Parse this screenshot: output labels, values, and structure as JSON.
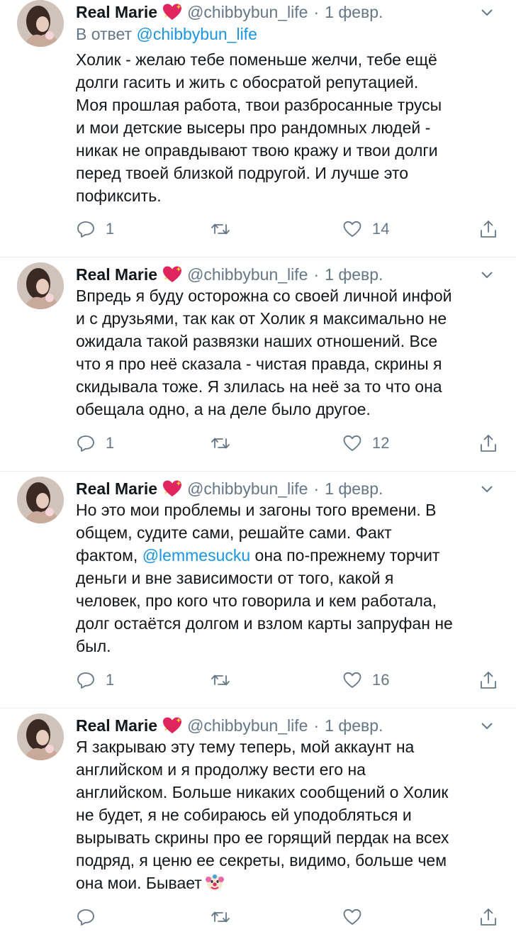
{
  "tweets": [
    {
      "author_name": "Real Marie",
      "handle": "@chibbybun_life",
      "separator": "·",
      "date": "1 февр.",
      "reply_prefix": "В ответ",
      "reply_to": "@chibbybun_life",
      "lines": [
        "Холик - желаю тебе поменьше желчи, тебе ещё",
        "долги гасить и жить с обосратой репутацией.",
        "Моя прошлая работа, твои разбросанные трусы",
        "и мои детские высеры про рандомных людей -",
        "никак не оправдывают твою кражу и твои долги",
        "перед твоей близкой подругой. И лучше это",
        "пофиксить."
      ],
      "reply_count": "1",
      "retweet_count": "",
      "like_count": "14"
    },
    {
      "author_name": "Real Marie",
      "handle": "@chibbybun_life",
      "separator": "·",
      "date": "1 февр.",
      "lines": [
        "Впредь я буду осторожна со своей личной инфой",
        "и с друзьями, так как от Холик я максимально не",
        "ожидала такой развязки наших отношений. Все",
        "что я про неё сказала - чистая правда, скрины я",
        "скидывала тоже. Я злилась на неё за то что она",
        "обещала одно, а на деле было другое."
      ],
      "reply_count": "1",
      "retweet_count": "",
      "like_count": "12"
    },
    {
      "author_name": "Real Marie",
      "handle": "@chibbybun_life",
      "separator": "·",
      "date": "1 февр.",
      "lines_before": [
        "Но это мои проблемы и загоны того времени. В",
        "общем, судите сами, решайте сами. Факт"
      ],
      "mention_prefix": "фактом, ",
      "mention": "@lemmesucku",
      "mention_suffix": " она по-прежнему торчит",
      "lines_after": [
        "деньги и вне зависимости от того, какой я",
        "человек, про кого что говорила и кем работала,",
        "долг остаётся долгом и взлом карты запруфан не",
        "был."
      ],
      "reply_count": "1",
      "retweet_count": "",
      "like_count": "16"
    },
    {
      "author_name": "Real Marie",
      "handle": "@chibbybun_life",
      "separator": "·",
      "date": "1 февр.",
      "lines": [
        "Я закрываю эту тему теперь, мой аккаунт на",
        "английском и я продолжу вести его на",
        "английском. Больше никаких сообщений о Холик",
        "не будет, я не собираюсь ей уподобляться и",
        "вырывать скрины про ее горящий пердак на всех",
        "подряд, я ценю ее секреты, видимо, больше чем"
      ],
      "last_line": "она мои. Бывает",
      "last_emoji": "clown-face-icon",
      "reply_count": "",
      "retweet_count": "",
      "like_count": ""
    }
  ],
  "icons": {
    "heart_emoji": "sparkling-heart-icon",
    "caret": "chevron-down-icon",
    "reply": "reply-icon",
    "retweet": "retweet-icon",
    "like": "like-icon",
    "share": "share-icon"
  },
  "colors": {
    "text": "#14171a",
    "secondary": "#657786",
    "link": "#1b95e0",
    "divider": "#e6ecf0",
    "heart": "#e0245e"
  }
}
